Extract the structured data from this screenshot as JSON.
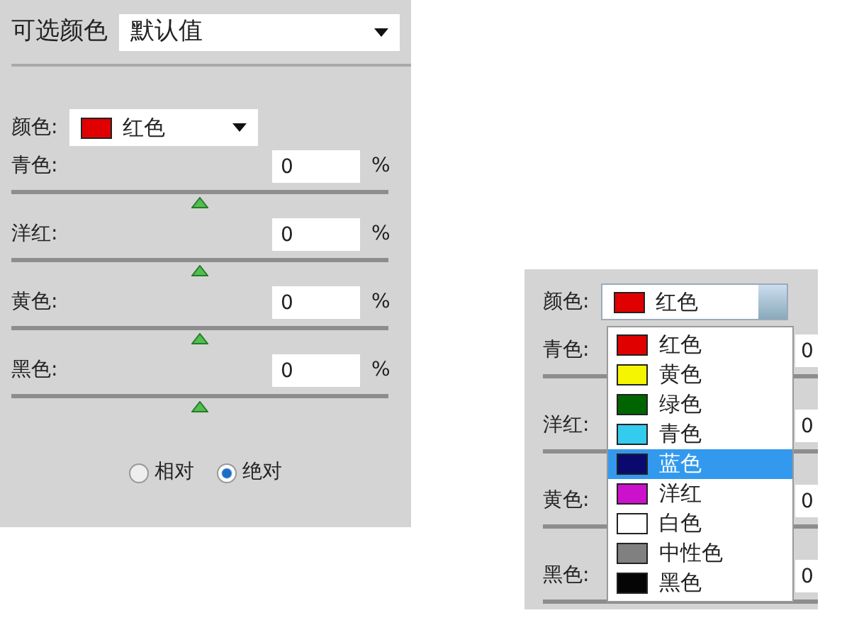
{
  "left_panel": {
    "title": "可选颜色",
    "preset": {
      "value": "默认值"
    },
    "color_select": {
      "label": "颜色:",
      "value": "红色",
      "color": "#e00000"
    },
    "sliders": [
      {
        "label": "青色:",
        "value": "0",
        "unit": "%",
        "level": 0.5
      },
      {
        "label": "洋红:",
        "value": "0",
        "unit": "%",
        "level": 0.5
      },
      {
        "label": "黄色:",
        "value": "0",
        "unit": "%",
        "level": 0.5
      },
      {
        "label": "黑色:",
        "value": "0",
        "unit": "%",
        "level": 0.5
      }
    ],
    "modes": [
      {
        "label": "相对",
        "selected": false
      },
      {
        "label": "绝对",
        "selected": true
      }
    ]
  },
  "right_panel": {
    "color_select": {
      "label": "颜色:",
      "value": "红色",
      "color": "#e00000"
    },
    "rows": [
      {
        "label": "青色:",
        "value": "0"
      },
      {
        "label": "洋红:",
        "value": "0"
      },
      {
        "label": "黄色:",
        "value": "0"
      },
      {
        "label": "黑色:",
        "value": "0"
      }
    ],
    "options": [
      {
        "label": "红色",
        "color": "#e00000",
        "selected": false
      },
      {
        "label": "黄色",
        "color": "#f5f500",
        "selected": false
      },
      {
        "label": "绿色",
        "color": "#006400",
        "selected": false
      },
      {
        "label": "青色",
        "color": "#33ccee",
        "selected": false
      },
      {
        "label": "蓝色",
        "color": "#0a0a6e",
        "selected": true
      },
      {
        "label": "洋红",
        "color": "#cc11cc",
        "selected": false
      },
      {
        "label": "白色",
        "color": "#ffffff",
        "selected": false
      },
      {
        "label": "中性色",
        "color": "#808080",
        "selected": false
      },
      {
        "label": "黑色",
        "color": "#050505",
        "selected": false
      }
    ]
  }
}
